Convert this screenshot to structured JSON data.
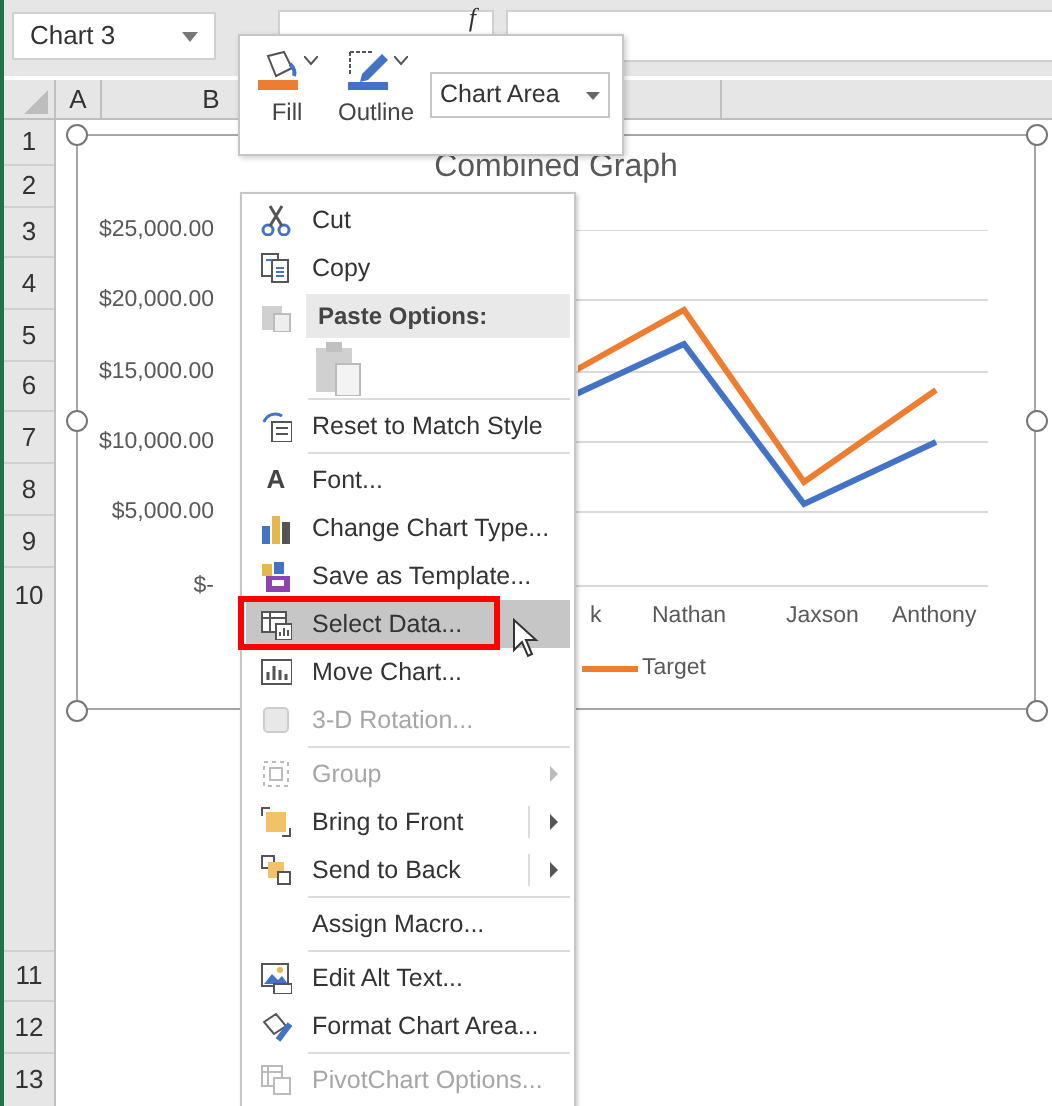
{
  "name_box": "Chart 3",
  "formula_label": "f",
  "columns": [
    "A",
    "B"
  ],
  "rows": [
    "1",
    "2",
    "3",
    "4",
    "5",
    "6",
    "7",
    "8",
    "9",
    "10",
    "11",
    "12",
    "13"
  ],
  "mini_toolbar": {
    "buttons": [
      "Fill",
      "Outline"
    ],
    "dropdown": "Chart Area"
  },
  "chart": {
    "title": "Combined Graph",
    "y_ticks": [
      "$25,000.00",
      "$20,000.00",
      "$15,000.00",
      "$10,000.00",
      "$5,000.00",
      "$-"
    ],
    "categories": [
      "k",
      "Nathan",
      "Jaxson",
      "Anthony"
    ],
    "legend": [
      {
        "label": "Target",
        "color": "#ed7d31"
      }
    ]
  },
  "context_menu": [
    {
      "kind": "command",
      "label": "Cut",
      "disabled": false,
      "selected": false,
      "submenu": false
    },
    {
      "kind": "command",
      "label": "Copy",
      "disabled": false,
      "selected": false,
      "submenu": false
    },
    {
      "kind": "heading",
      "label": "Paste Options:"
    },
    {
      "kind": "paste",
      "disabled": true
    },
    {
      "kind": "separator"
    },
    {
      "kind": "command",
      "label": "Reset to Match Style",
      "disabled": false,
      "selected": false,
      "submenu": false
    },
    {
      "kind": "separator"
    },
    {
      "kind": "command",
      "label": "Font...",
      "glyph": "A",
      "disabled": false,
      "selected": false,
      "submenu": false
    },
    {
      "kind": "command",
      "label": "Change Chart Type...",
      "disabled": false,
      "selected": false,
      "submenu": false
    },
    {
      "kind": "command",
      "label": "Save as Template...",
      "disabled": false,
      "selected": false,
      "submenu": false
    },
    {
      "kind": "command",
      "label": "Select Data...",
      "disabled": false,
      "selected": true,
      "submenu": false
    },
    {
      "kind": "command",
      "label": "Move Chart...",
      "disabled": false,
      "selected": false,
      "submenu": false
    },
    {
      "kind": "command",
      "label": "3-D Rotation...",
      "disabled": true,
      "selected": false,
      "submenu": false
    },
    {
      "kind": "separator"
    },
    {
      "kind": "command",
      "label": "Group",
      "disabled": true,
      "selected": false,
      "submenu": true
    },
    {
      "kind": "command",
      "label": "Bring to Front",
      "disabled": false,
      "selected": false,
      "submenu": true
    },
    {
      "kind": "command",
      "label": "Send to Back",
      "disabled": false,
      "selected": false,
      "submenu": true
    },
    {
      "kind": "separator"
    },
    {
      "kind": "command",
      "label": "Assign Macro...",
      "disabled": false,
      "selected": false,
      "submenu": false
    },
    {
      "kind": "separator"
    },
    {
      "kind": "command",
      "label": "Edit Alt Text...",
      "disabled": false,
      "selected": false,
      "submenu": false
    },
    {
      "kind": "command",
      "label": "Format Chart Area...",
      "disabled": false,
      "selected": false,
      "submenu": false
    },
    {
      "kind": "separator"
    },
    {
      "kind": "command",
      "label": "PivotChart Options...",
      "disabled": true,
      "selected": false,
      "submenu": false
    }
  ]
}
